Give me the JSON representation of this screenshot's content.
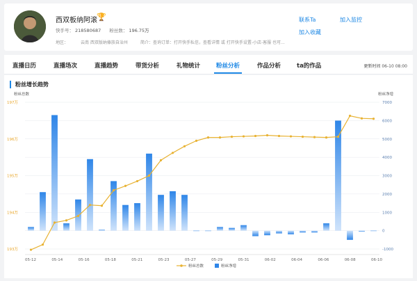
{
  "profile": {
    "name": "西双板纳阿滚",
    "medal_icon": "trophy-icon",
    "kuaishou_id_label": "快手号：",
    "kuaishou_id": "218580687",
    "fans_label": "粉丝数：",
    "fans": "196.75万",
    "region_label": "地区：",
    "region": "云南 西双版纳傣族自治州",
    "bio_label": "简介：",
    "bio": "查询订单：打开快手私信，查看详情 或 打开快手设置-小店-客服 也可..."
  },
  "actions": {
    "contact": "联系Ta",
    "add_monitor": "加入监控",
    "add_favorite": "加入收藏"
  },
  "tabs": [
    {
      "label": "直播日历"
    },
    {
      "label": "直播场次"
    },
    {
      "label": "直播趋势"
    },
    {
      "label": "带货分析"
    },
    {
      "label": "礼物统计"
    },
    {
      "label": "粉丝分析"
    },
    {
      "label": "作品分析"
    },
    {
      "label": "ta的作品"
    }
  ],
  "active_tab": "粉丝分析",
  "update_time": "更新时间 06-10 08:00",
  "section_title": "粉丝增长趋势",
  "colors": {
    "accent": "#1e88e5",
    "line": "#e8b232",
    "bar": "#2f86e8"
  },
  "chart_data": {
    "type": "bar+line",
    "title": "粉丝增长趋势",
    "ylabel_left": "粉丝总数",
    "ylabel_right": "粉丝净增",
    "y_left_ticks": [
      "197万",
      "196万",
      "195万",
      "194万",
      "193万"
    ],
    "y_right_ticks": [
      "7000",
      "6000",
      "5000",
      "4000",
      "3000",
      "2000",
      "1000",
      "0",
      "-1000"
    ],
    "ylim_left": [
      193,
      197
    ],
    "ylim_right": [
      -1000,
      7000
    ],
    "x_tick_labels": [
      "05-12",
      "05-14",
      "05-16",
      "05-18",
      "05-21",
      "05-23",
      "05-27",
      "05-29",
      "05-31",
      "06-02",
      "06-04",
      "06-06",
      "06-08",
      "06-10"
    ],
    "legend": [
      {
        "name": "粉丝总数",
        "kind": "line"
      },
      {
        "name": "粉丝净增",
        "kind": "bar"
      }
    ],
    "legend_position": "bottom",
    "grid": true,
    "series": [
      {
        "name": "粉丝总数",
        "kind": "line",
        "axis": "left",
        "values": [
          192.98,
          193.12,
          193.72,
          193.78,
          193.9,
          194.2,
          194.18,
          194.6,
          194.72,
          194.85,
          195.0,
          195.42,
          195.62,
          195.8,
          195.95,
          196.04,
          196.04,
          196.06,
          196.07,
          196.08,
          196.1,
          196.08,
          196.07,
          196.06,
          196.05,
          196.04,
          196.06,
          196.63,
          196.56,
          196.55
        ]
      },
      {
        "name": "粉丝净增",
        "kind": "bar",
        "axis": "right",
        "values": [
          200,
          2100,
          6300,
          400,
          1700,
          3900,
          50,
          2700,
          1400,
          1500,
          4200,
          1950,
          2150,
          1950,
          0,
          0,
          200,
          150,
          300,
          -300,
          -250,
          -150,
          -200,
          -100,
          -100,
          400,
          6000,
          -500,
          -50,
          0
        ]
      }
    ]
  }
}
